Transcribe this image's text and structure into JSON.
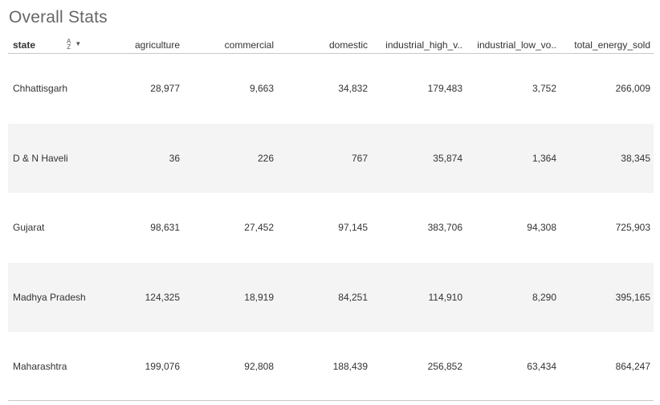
{
  "title": "Overall Stats",
  "columns": {
    "state": "state",
    "agriculture": "agriculture",
    "commercial": "commercial",
    "domestic": "domestic",
    "industrial_high": "industrial_high_v..",
    "industrial_low": "industrial_low_vo..",
    "total": "total_energy_sold"
  },
  "sort_icon": {
    "az_top": "A",
    "az_bottom": "Z",
    "arrow": "▼"
  },
  "rows": [
    {
      "state": "Chhattisgarh",
      "agriculture": "28,977",
      "commercial": "9,663",
      "domestic": "34,832",
      "industrial_high": "179,483",
      "industrial_low": "3,752",
      "total": "266,009"
    },
    {
      "state": "D & N Haveli",
      "agriculture": "36",
      "commercial": "226",
      "domestic": "767",
      "industrial_high": "35,874",
      "industrial_low": "1,364",
      "total": "38,345"
    },
    {
      "state": "Gujarat",
      "agriculture": "98,631",
      "commercial": "27,452",
      "domestic": "97,145",
      "industrial_high": "383,706",
      "industrial_low": "94,308",
      "total": "725,903"
    },
    {
      "state": "Madhya Pradesh",
      "agriculture": "124,325",
      "commercial": "18,919",
      "domestic": "84,251",
      "industrial_high": "114,910",
      "industrial_low": "8,290",
      "total": "395,165"
    },
    {
      "state": "Maharashtra",
      "agriculture": "199,076",
      "commercial": "92,808",
      "domestic": "188,439",
      "industrial_high": "256,852",
      "industrial_low": "63,434",
      "total": "864,247"
    }
  ]
}
